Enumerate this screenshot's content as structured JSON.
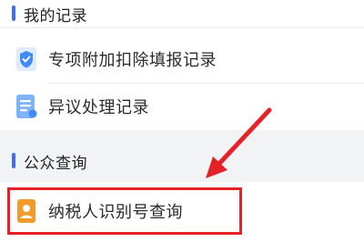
{
  "sections": {
    "records": {
      "title": "我的记录",
      "items": [
        {
          "label": "专项附加扣除填报记录",
          "icon": "shield-check-icon"
        },
        {
          "label": "异议处理记录",
          "icon": "document-list-icon"
        }
      ]
    },
    "public": {
      "title": "公众查询",
      "items": [
        {
          "label": "纳税人识别号查询",
          "icon": "id-badge-icon"
        }
      ]
    }
  },
  "colors": {
    "accent": "#3b6ff5",
    "highlight": "#e52228",
    "icon_blue": "#3f8bf3",
    "icon_orange": "#f39a2b"
  }
}
